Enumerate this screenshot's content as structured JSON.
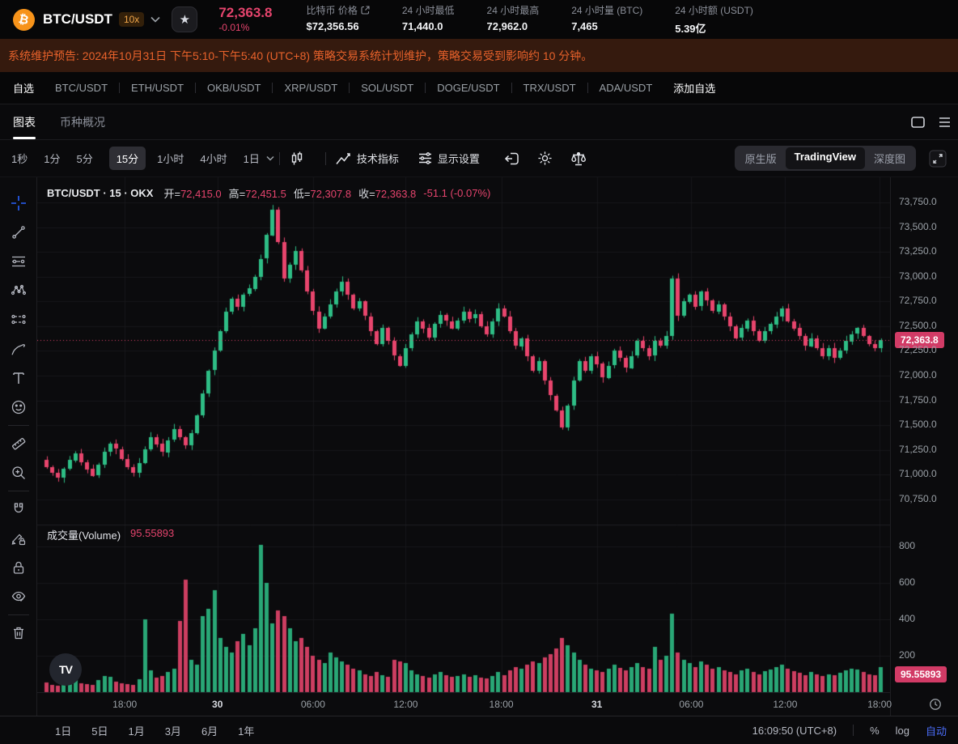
{
  "header": {
    "pair": "BTC/USDT",
    "leverage": "10x",
    "price": "72,363.8",
    "change": "-0.01%",
    "stats": [
      {
        "label": "比特币 价格",
        "value": "$72,356.56",
        "external": true
      },
      {
        "label": "24 小时最低",
        "value": "71,440.0",
        "external": false
      },
      {
        "label": "24 小时最高",
        "value": "72,962.0",
        "external": false
      },
      {
        "label": "24 小时量 (BTC)",
        "value": "7,465",
        "external": false
      },
      {
        "label": "24 小时额 (USDT)",
        "value": "5.39亿",
        "external": false
      }
    ]
  },
  "banner": {
    "text": "系统维护预告: 2024年10月31日 下午5:10-下午5:40 (UTC+8) 策略交易系统计划维护，策略交易受到影响约 10 分钟。",
    "text_color": "#E8622B",
    "bg_color": "#351A0E"
  },
  "watchlist": {
    "my": "自选",
    "pairs": [
      "BTC/USDT",
      "ETH/USDT",
      "OKB/USDT",
      "XRP/USDT",
      "SOL/USDT",
      "DOGE/USDT",
      "TRX/USDT",
      "ADA/USDT"
    ],
    "add": "添加自选"
  },
  "view_tabs": {
    "chart": "图表",
    "overview": "币种概况"
  },
  "toolbar": {
    "intervals": [
      "1秒",
      "1分",
      "5分",
      "15分",
      "1小时",
      "4小时",
      "1日"
    ],
    "active_interval": "15分",
    "indicators": "技术指标",
    "display_settings": "显示设置",
    "modes": [
      "原生版",
      "TradingView",
      "深度图"
    ],
    "active_mode": "TradingView"
  },
  "legend": {
    "title": "BTC/USDT · 15 · OKX",
    "items": [
      {
        "k": "开=",
        "v": "72,415.0"
      },
      {
        "k": "高=",
        "v": "72,451.5"
      },
      {
        "k": "低=",
        "v": "72,307.8"
      },
      {
        "k": "收=",
        "v": "72,363.8"
      }
    ],
    "change": "-51.1 (-0.07%)"
  },
  "volume_legend": {
    "label": "成交量(Volume)",
    "value": "95.55893"
  },
  "sidebar_tools": [
    "crosshair",
    "trend-line",
    "fib-lines",
    "xabcd-pattern",
    "projection",
    "brush",
    "text",
    "emoji",
    "ruler",
    "zoom-in",
    "magnet",
    "draw-lock",
    "lock",
    "hide-drawings",
    "delete"
  ],
  "bottom": {
    "ranges": [
      "1日",
      "5日",
      "1月",
      "3月",
      "6月",
      "1年"
    ],
    "clock": "16:09:50 (UTC+8)",
    "percent": "%",
    "log": "log",
    "auto": "自动"
  },
  "chart_data": {
    "type": "candlestick",
    "symbol": "BTC/USDT",
    "interval": "15",
    "exchange": "OKX",
    "ohlc_display": {
      "open": 72415.0,
      "high": 72451.5,
      "low": 72307.8,
      "close": 72363.8,
      "change": -51.1,
      "change_pct": -0.07
    },
    "current_price": {
      "v": 72363.8,
      "label": "72,363.8"
    },
    "price_ticks": [
      {
        "v": 73750,
        "label": "73,750.0"
      },
      {
        "v": 73500,
        "label": "73,500.0"
      },
      {
        "v": 73250,
        "label": "73,250.0"
      },
      {
        "v": 73000,
        "label": "73,000.0"
      },
      {
        "v": 72750,
        "label": "72,750.0"
      },
      {
        "v": 72500,
        "label": "72,500.0"
      },
      {
        "v": 72250,
        "label": "72,250.0"
      },
      {
        "v": 72000,
        "label": "72,000.0"
      },
      {
        "v": 71750,
        "label": "71,750.0"
      },
      {
        "v": 71500,
        "label": "71,500.0"
      },
      {
        "v": 71250,
        "label": "71,250.0"
      },
      {
        "v": 71000,
        "label": "71,000.0"
      },
      {
        "v": 70750,
        "label": "70,750.0"
      }
    ],
    "x_ticks": [
      {
        "label": "18:00",
        "index": 13.5,
        "bold": false
      },
      {
        "label": "30",
        "index": 29.5,
        "bold": true
      },
      {
        "label": "06:00",
        "index": 46,
        "bold": false
      },
      {
        "label": "12:00",
        "index": 62,
        "bold": false
      },
      {
        "label": "18:00",
        "index": 78.5,
        "bold": false
      },
      {
        "label": "31",
        "index": 95,
        "bold": true
      },
      {
        "label": "06:00",
        "index": 111.3,
        "bold": false
      },
      {
        "label": "12:00",
        "index": 127.5,
        "bold": false
      },
      {
        "label": "18:00",
        "index": 143.8,
        "bold": false
      }
    ],
    "first_open": 71150,
    "closes": [
      71080,
      71020,
      70970,
      71060,
      71150,
      71220,
      71130,
      71060,
      70990,
      71100,
      71230,
      71310,
      71260,
      71160,
      71080,
      71020,
      71120,
      71260,
      71380,
      71310,
      71230,
      71350,
      71460,
      71380,
      71300,
      71420,
      71600,
      71820,
      72050,
      72250,
      72450,
      72650,
      72780,
      72700,
      72820,
      72880,
      73000,
      73180,
      73420,
      73680,
      73350,
      72980,
      73120,
      73260,
      73060,
      72850,
      72650,
      72480,
      72600,
      72720,
      72850,
      72950,
      72820,
      72680,
      72750,
      72600,
      72450,
      72320,
      72480,
      72350,
      72200,
      72100,
      72280,
      72420,
      72550,
      72480,
      72380,
      72520,
      72610,
      72550,
      72480,
      72560,
      72650,
      72580,
      72620,
      72500,
      72420,
      72550,
      72680,
      72600,
      72450,
      72300,
      72380,
      72200,
      72050,
      72150,
      71950,
      71800,
      71650,
      71480,
      71700,
      71950,
      72150,
      72050,
      72200,
      72120,
      71980,
      72100,
      72250,
      72180,
      72080,
      72200,
      72350,
      72280,
      72200,
      72350,
      72300,
      72400,
      72980,
      72600,
      72750,
      72820,
      72700,
      72850,
      72760,
      72650,
      72720,
      72600,
      72500,
      72380,
      72480,
      72560,
      72450,
      72350,
      72450,
      72520,
      72600,
      72680,
      72550,
      72480,
      72400,
      72300,
      72380,
      72280,
      72200,
      72280,
      72180,
      72250,
      72350,
      72420,
      72480,
      72400,
      72320,
      72280,
      72364
    ],
    "volumes": [
      55,
      40,
      35,
      60,
      80,
      70,
      50,
      45,
      40,
      65,
      90,
      85,
      60,
      50,
      45,
      40,
      70,
      400,
      120,
      80,
      90,
      110,
      130,
      390,
      620,
      180,
      150,
      420,
      460,
      560,
      300,
      250,
      220,
      280,
      320,
      260,
      350,
      810,
      600,
      380,
      450,
      420,
      350,
      280,
      300,
      250,
      200,
      180,
      160,
      220,
      190,
      170,
      150,
      130,
      120,
      100,
      90,
      110,
      95,
      85,
      180,
      170,
      160,
      120,
      100,
      90,
      80,
      100,
      110,
      95,
      85,
      90,
      100,
      85,
      95,
      80,
      75,
      90,
      110,
      95,
      120,
      140,
      130,
      150,
      170,
      160,
      190,
      210,
      240,
      300,
      260,
      220,
      180,
      150,
      130,
      120,
      110,
      130,
      150,
      135,
      120,
      140,
      160,
      140,
      130,
      250,
      180,
      200,
      430,
      220,
      180,
      160,
      140,
      170,
      150,
      130,
      140,
      120,
      110,
      100,
      120,
      130,
      110,
      100,
      115,
      125,
      140,
      150,
      130,
      115,
      105,
      95,
      110,
      100,
      90,
      100,
      95,
      105,
      120,
      130,
      125,
      110,
      100,
      95,
      140
    ],
    "volume_ticks": [
      {
        "v": 800,
        "label": "800"
      },
      {
        "v": 600,
        "label": "600"
      },
      {
        "v": 400,
        "label": "400"
      },
      {
        "v": 200,
        "label": "200"
      }
    ],
    "volume_current": {
      "v": 95.55893,
      "label": "95.55893"
    },
    "colors": {
      "up": "#2EBD85",
      "down": "#E8456D",
      "badge": "#D23B66",
      "grid": "#17171B",
      "axis_text": "#9AA0A6",
      "crosshair_blue": "#2962FF",
      "accent_blue": "#4A6CF7"
    }
  }
}
